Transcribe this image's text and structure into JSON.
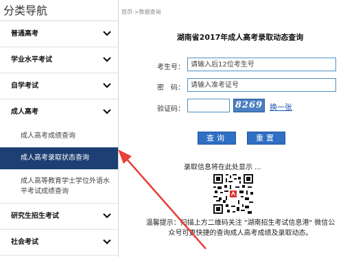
{
  "sidebar": {
    "title": "分类导航",
    "items": [
      {
        "label": "普通高考"
      },
      {
        "label": "学业水平考试"
      },
      {
        "label": "自学考试"
      },
      {
        "label": "成人高考"
      }
    ],
    "sub_items": [
      {
        "label": "成人高考成绩查询"
      },
      {
        "label": "成人高考录取状态查询"
      },
      {
        "label": "成人高等教育学士学位外语水平考试成绩查询"
      }
    ],
    "items_after": [
      {
        "label": "研究生招生考试"
      },
      {
        "label": "社会考试"
      }
    ]
  },
  "breadcrumb": "首页->数据查询",
  "page_title": "湖南省2017年成人高考录取动态查询",
  "form": {
    "exam_no_label": "考生号：",
    "exam_no_placeholder": "请输入后12位考生号",
    "password_label": "密　码：",
    "password_placeholder": "请输入准考证号",
    "captcha_label": "验证码：",
    "captcha_value": "",
    "captcha_image_text": "8269",
    "refresh_label": "换一张"
  },
  "buttons": {
    "query": "查询",
    "reset": "重置"
  },
  "info_text": "录取信息将在此处显示 ...",
  "tip": "温馨提示：扫描上方二维码关注 \"湖南招生考试信息港\" 微信公众号可更快捷的查询成人高考成绩及录取动态。",
  "colors": {
    "active_bg": "#1d3f73",
    "button_bg": "#2f6fc4",
    "arrow": "#e8403a"
  }
}
